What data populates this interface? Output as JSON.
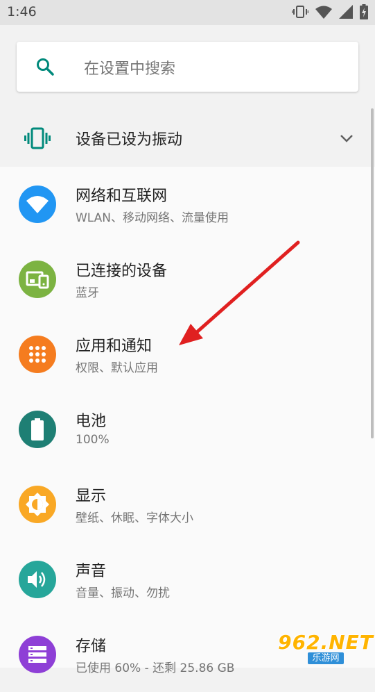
{
  "status_bar": {
    "time": "1:46",
    "icons": [
      "vibrate-icon",
      "wifi-icon",
      "signal-icon",
      "battery-charging-icon"
    ]
  },
  "search": {
    "placeholder": "在设置中搜索",
    "icon": "search-icon"
  },
  "condition": {
    "label": "设备已设为振动",
    "icon": "vibrate-icon",
    "expand_icon": "chevron-down-icon"
  },
  "settings": [
    {
      "title": "网络和互联网",
      "subtitle": "WLAN、移动网络、流量使用",
      "icon": "wifi-icon",
      "color": "#2196f3"
    },
    {
      "title": "已连接的设备",
      "subtitle": "蓝牙",
      "icon": "devices-icon",
      "color": "#7cb342"
    },
    {
      "title": "应用和通知",
      "subtitle": "权限、默认应用",
      "icon": "apps-icon",
      "color": "#f57c1f"
    },
    {
      "title": "电池",
      "subtitle": "100%",
      "icon": "battery-icon",
      "color": "#1e7f74"
    },
    {
      "title": "显示",
      "subtitle": "壁纸、休眠、字体大小",
      "icon": "brightness-icon",
      "color": "#f9a825"
    },
    {
      "title": "声音",
      "subtitle": "音量、振动、勿扰",
      "icon": "volume-icon",
      "color": "#26a69a"
    },
    {
      "title": "存储",
      "subtitle": "已使用 60% - 还剩 25.86 GB",
      "icon": "storage-icon",
      "color": "#8e3fd6"
    }
  ],
  "annotation": {
    "icon": "red-arrow-icon",
    "color": "#e02020"
  },
  "watermark": {
    "brand": "962.NET",
    "site": "乐游网"
  },
  "colors": {
    "accent": "#00897b",
    "status_bar": "#e3e3e3",
    "background": "#fafafa"
  }
}
